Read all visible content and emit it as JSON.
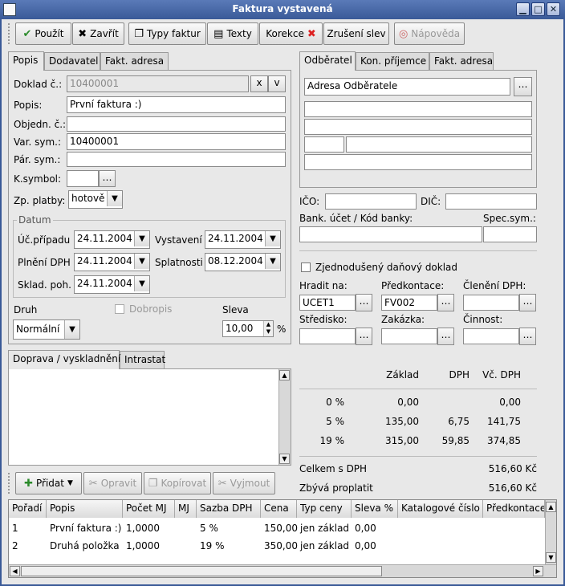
{
  "window": {
    "title": "Faktura vystavená"
  },
  "toolbar": {
    "use": "Použít",
    "close": "Zavřít",
    "invoice_types": "Typy faktur",
    "texts": "Texty",
    "correction": "Korekce",
    "cancel_discounts": "Zrušení slev",
    "help": "Nápověda"
  },
  "left_tabs": [
    "Popis",
    "Dodavatel",
    "Fakt. adresa"
  ],
  "form": {
    "doklad_label": "Doklad č.:",
    "doklad_value": "10400001",
    "doklad_x": "x",
    "doklad_v": "v",
    "popis_label": "Popis:",
    "popis_value": "První faktura :)",
    "objedn_label": "Objedn. č.:",
    "objedn_value": "",
    "varsym_label": "Var. sym.:",
    "varsym_value": "10400001",
    "parsym_label": "Pár. sym.:",
    "parsym_value": "",
    "ksymbol_label": "K.symbol:",
    "ksymbol_value": "",
    "zp_label": "Zp. platby:",
    "zp_value": "hotově",
    "datum_title": "Datum",
    "uc_label": "Úč.případu",
    "uc_value": "24.11.2004",
    "vyst_label": "Vystavení",
    "vyst_value": "24.11.2004",
    "pln_label": "Plnění DPH",
    "pln_value": "24.11.2004",
    "spl_label": "Splatnosti",
    "spl_value": "08.12.2004",
    "sklad_label": "Sklad. poh.",
    "sklad_value": "24.11.2004",
    "druh_label": "Druh",
    "druh_value": "Normální",
    "dobropis_label": "Dobropis",
    "sleva_label": "Sleva",
    "sleva_value": "10,00",
    "sleva_unit": "%"
  },
  "right_tabs": [
    "Odběratel",
    "Kon. příjemce",
    "Fakt. adresa"
  ],
  "customer": {
    "address": "Adresa Odběratele",
    "ico_label": "IČO:",
    "dic_label": "DIČ:",
    "bank_label": "Bank. účet / Kód banky:",
    "spec_label": "Spec.sym.:",
    "simplified_label": "Zjednodušený daňový doklad",
    "hradit_label": "Hradit na:",
    "hradit_value": "UCET1",
    "predkont_label": "Předkontace:",
    "predkont_value": "FV002",
    "cleneni_label": "Členění DPH:",
    "cleneni_value": "",
    "stredisko_label": "Středisko:",
    "zakazka_label": "Zakázka:",
    "cinnost_label": "Činnost:"
  },
  "bottom_tabs": [
    "Doprava / vyskladnění",
    "Intrastat"
  ],
  "vat_summary": {
    "headers": [
      "Základ",
      "DPH",
      "Vč. DPH"
    ],
    "rows": [
      {
        "rate": "0 %",
        "base": "0,00",
        "vat": "",
        "total": "0,00"
      },
      {
        "rate": "5 %",
        "base": "135,00",
        "vat": "6,75",
        "total": "141,75"
      },
      {
        "rate": "19 %",
        "base": "315,00",
        "vat": "59,85",
        "total": "374,85"
      }
    ],
    "total_label": "Celkem s DPH",
    "total_value": "516,60 Kč",
    "remaining_label": "Zbývá proplatit",
    "remaining_value": "516,60 Kč"
  },
  "items_toolbar": {
    "add": "Přidat",
    "edit": "Opravit",
    "copy": "Kopírovat",
    "cut": "Vyjmout"
  },
  "table": {
    "columns": [
      "Pořadí",
      "Popis",
      "Počet MJ",
      "MJ",
      "Sazba DPH",
      "Cena",
      "Typ ceny",
      "Sleva %",
      "Katalogové číslo",
      "Předkontace"
    ],
    "rows": [
      [
        "1",
        "První faktura :)",
        "1,0000",
        "",
        "5 %",
        "150,00",
        "jen základ",
        "0,00"
      ],
      [
        "2",
        "Druhá položka",
        "1,0000",
        "",
        "19 %",
        "350,00",
        "jen základ",
        "0,00"
      ]
    ]
  }
}
